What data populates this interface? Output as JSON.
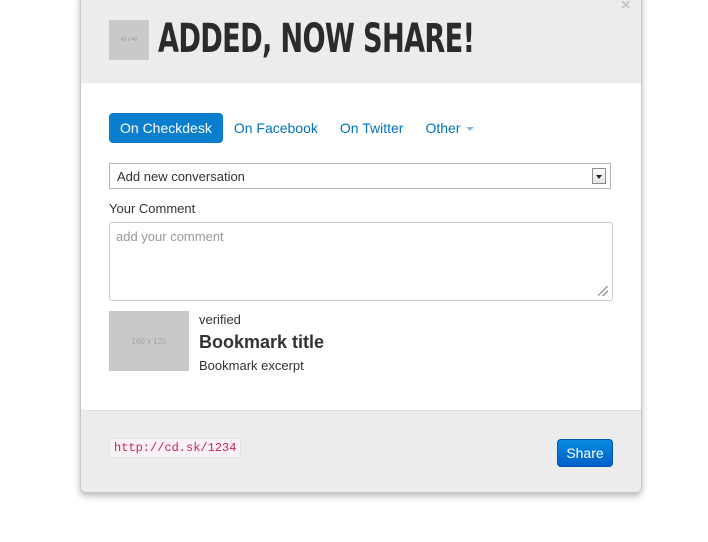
{
  "header": {
    "thumbnail_text": "40 x 40",
    "title": "ADDED, NOW SHARE!",
    "close_icon": "×"
  },
  "tabs": [
    {
      "label": "On Checkdesk",
      "active": true
    },
    {
      "label": "On Facebook",
      "active": false
    },
    {
      "label": "On Twitter",
      "active": false
    },
    {
      "label": "Other",
      "active": false,
      "dropdown": true
    }
  ],
  "conversation_select": {
    "value": "Add new conversation"
  },
  "comment": {
    "label": "Your Comment",
    "placeholder": "add your comment",
    "value": ""
  },
  "bookmark": {
    "thumbnail_text": "160 x 120",
    "status": "verified",
    "title": "Bookmark title",
    "excerpt": "Bookmark excerpt"
  },
  "footer": {
    "short_url": "http://cd.sk/1234",
    "share_label": "Share"
  },
  "colors": {
    "accent": "#0a7fcf",
    "link": "#0073bb",
    "header_bg": "#ececec",
    "url_text": "#c7254e"
  },
  "icons": {
    "close": "close-icon",
    "dropdown": "caret-down-icon",
    "select_arrow": "select-arrow-icon",
    "resize": "resize-handle-icon"
  }
}
